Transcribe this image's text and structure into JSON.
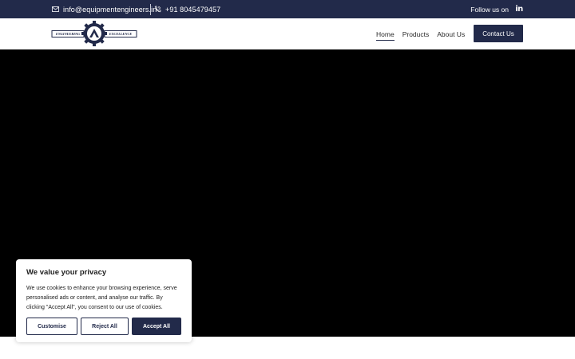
{
  "topbar": {
    "email": "info@equipmentengineers.in",
    "phone": "+91 8045479457",
    "follow_label": "Follow us on",
    "email_icon": "mail-icon",
    "phone_icon": "phone-icon",
    "social_icon": "linkedin-icon",
    "social_glyph": "in"
  },
  "logo": {
    "left_text": "ENGINEERING",
    "right_text": "EXCELLENCE"
  },
  "nav": {
    "items": [
      {
        "label": "Home",
        "active": true
      },
      {
        "label": "Products",
        "active": false
      },
      {
        "label": "About Us",
        "active": false
      }
    ],
    "contact_label": "Contact Us"
  },
  "cookie": {
    "title": "We value your privacy",
    "text": "We use cookies to enhance your browsing experience, serve personalised ads or content, and analyse our traffic. By clicking \"Accept All\", you consent to our use of cookies.",
    "customise_label": "Customise",
    "reject_label": "Reject All",
    "accept_label": "Accept All"
  },
  "colors": {
    "brand": "#222a4a",
    "hero": "#000000",
    "text": "#212121"
  }
}
